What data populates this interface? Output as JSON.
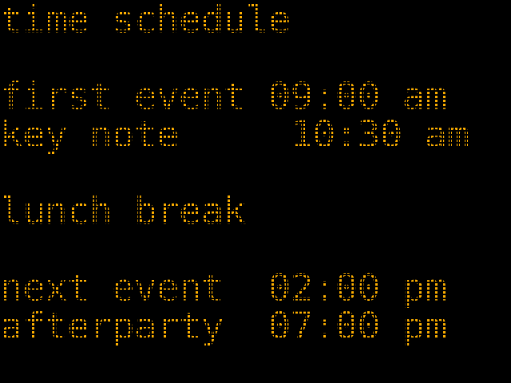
{
  "display": {
    "title": "time schedule",
    "rows": [
      {
        "label": "first event",
        "time": "09:00",
        "period": "am"
      },
      {
        "label": "key note",
        "time": "10:30",
        "period": "am"
      },
      {
        "label": "lunch break"
      },
      {
        "label": "next event",
        "time": "02:00",
        "period": "pm"
      },
      {
        "label": "afterparty",
        "time": "07:00",
        "period": "pm"
      }
    ],
    "lines": [
      "time schedule",
      "first event 09:00 am",
      "key note     10:30 am",
      "lunch break",
      "next event  02:00 pm",
      "afterparty  07:00 pm"
    ],
    "colors": {
      "background": "#000000",
      "led": "#ffb000"
    }
  }
}
